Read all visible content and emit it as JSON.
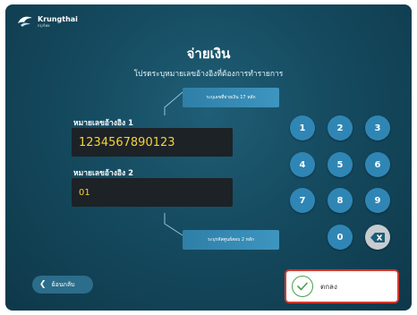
{
  "brand": {
    "name": "Krungthai",
    "sub": "กรุงไทย"
  },
  "page": {
    "title": "จ่ายเงิน",
    "subtitle": "โปรดระบุหมายเลขอ้างอิงที่ต้องการทำรายการ"
  },
  "hints": {
    "top": "ระบุเลขที่จ่ายเงิน 17 หลัก",
    "bottom": "ระบุรหัสศูนย์สอบ 2 หลัก"
  },
  "fields": {
    "ref1_label": "หมายเลขอ้างอิง 1",
    "ref1_value": "1234567890123",
    "ref2_label": "หมายเลขอ้างอิง 2",
    "ref2_value": "01"
  },
  "keypad": {
    "keys": [
      "1",
      "2",
      "3",
      "4",
      "5",
      "6",
      "7",
      "8",
      "9",
      "0"
    ],
    "backspace_icon": "backspace-icon"
  },
  "footer": {
    "back_label": "ย้อนกลับ",
    "ok_label": "ตกลง"
  },
  "colors": {
    "background": "#154a5f",
    "key": "#2f86b5",
    "hint": "#3d95c0",
    "field_text": "#f7d13a",
    "ok_border": "#d43a2e",
    "ok_check": "#46a04a"
  }
}
